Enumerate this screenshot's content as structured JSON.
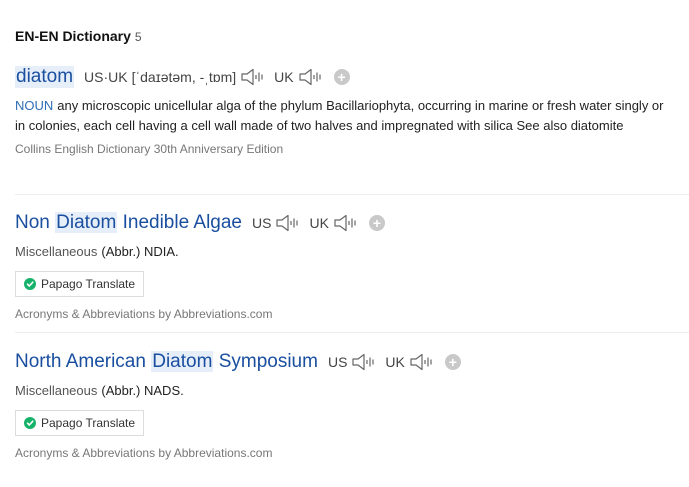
{
  "section": {
    "title": "EN-EN Dictionary",
    "count": "5"
  },
  "entries": [
    {
      "word": "diatom",
      "pron_us_label": "US·UK",
      "pron_ipa": "[ˈdaɪətəm, -ˌtɒm]",
      "pron_uk_label": "UK",
      "pos": "NOUN",
      "definition": "any microscopic unicellular alga of the phylum Bacillariophyta, occurring in marine or fresh water singly or in colonies, each cell having a cell wall made of two halves and impregnated with silica See also diatomite",
      "source": "Collins English Dictionary 30th Anniversary Edition"
    },
    {
      "word_pre": "Non ",
      "word_hl": "Diatom",
      "word_post": " Inedible Algae",
      "us_label": "US",
      "uk_label": "UK",
      "category": "Miscellaneous",
      "abbr": "(Abbr.) NDIA.",
      "translate_label": "Papago Translate",
      "source": "Acronyms & Abbreviations by Abbreviations.com"
    },
    {
      "word_pre": "North American ",
      "word_hl": "Diatom",
      "word_post": " Symposium",
      "us_label": "US",
      "uk_label": "UK",
      "category": "Miscellaneous",
      "abbr": "(Abbr.) NADS.",
      "translate_label": "Papago Translate",
      "source": "Acronyms & Abbreviations by Abbreviations.com"
    }
  ],
  "colors": {
    "link": "#1a4fa0",
    "pos": "#2f6db5",
    "highlight": "#e6eef9"
  },
  "icons": [
    "speaker-icon",
    "add-icon",
    "papago-logo"
  ]
}
